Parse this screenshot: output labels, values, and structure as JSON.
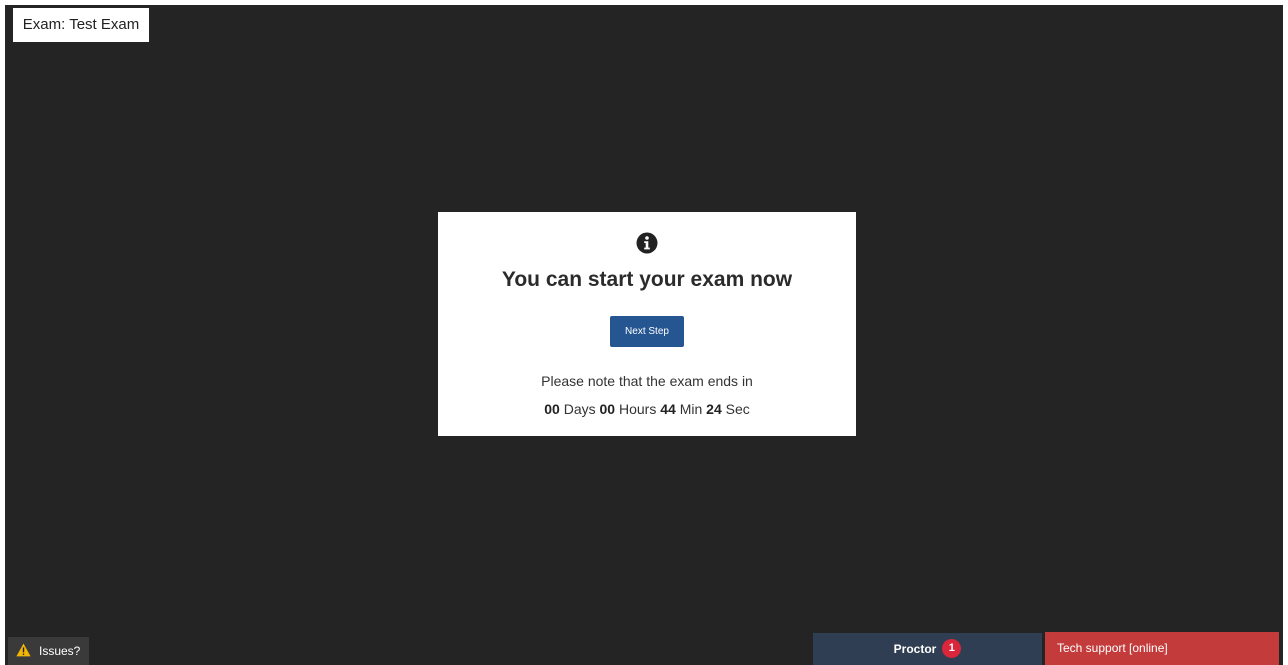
{
  "exam": {
    "title": "Exam: Test Exam"
  },
  "modal": {
    "icon": "info-circle-icon",
    "heading": "You can start your exam now",
    "next_label": "Next Step",
    "note": "Please note that the exam ends in",
    "countdown": {
      "days": "00",
      "days_label": "Days",
      "hours": "00",
      "hours_label": "Hours",
      "minutes": "44",
      "minutes_label": "Min",
      "seconds": "24",
      "seconds_label": "Sec"
    },
    "button_color": "#255691"
  },
  "footer": {
    "issues_label": "Issues?",
    "issues_icon": "warning-icon",
    "proctor_label": "Proctor",
    "proctor_badge": "1",
    "support_label": "Tech support [online]",
    "proctor_color": "#2f3e52",
    "support_color": "#c43b3b",
    "badge_color": "#d9263a"
  }
}
